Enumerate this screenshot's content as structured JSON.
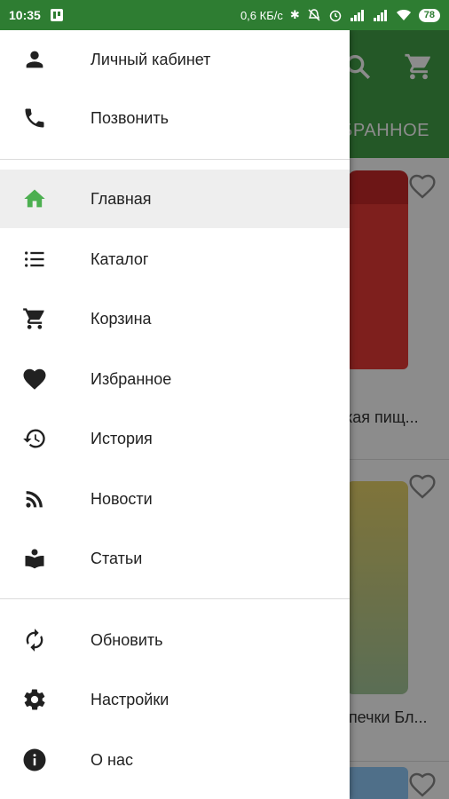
{
  "status_bar": {
    "time": "10:35",
    "network_speed": "0,6 КБ/с",
    "battery": "78"
  },
  "app": {
    "tab_label": "БРАННОЕ",
    "products": [
      {
        "title": "ская пищ..."
      },
      {
        "title": "ыпечки Бл..."
      }
    ]
  },
  "drawer": {
    "account": {
      "label": "Личный кабинет",
      "icon": "person-icon"
    },
    "call": {
      "label": "Позвонить",
      "icon": "phone-icon"
    },
    "items": [
      {
        "label": "Главная",
        "icon": "home-icon",
        "active": true
      },
      {
        "label": "Каталог",
        "icon": "list-icon"
      },
      {
        "label": "Корзина",
        "icon": "cart-icon"
      },
      {
        "label": "Избранное",
        "icon": "heart-icon"
      },
      {
        "label": "История",
        "icon": "history-icon"
      },
      {
        "label": "Новости",
        "icon": "rss-icon"
      },
      {
        "label": "Статьи",
        "icon": "book-icon"
      }
    ],
    "footer": [
      {
        "label": "Обновить",
        "icon": "refresh-icon"
      },
      {
        "label": "Настройки",
        "icon": "gear-icon"
      },
      {
        "label": "О нас",
        "icon": "info-icon"
      }
    ]
  },
  "colors": {
    "primary": "#43a047",
    "status_bar": "#2e7d32",
    "active_icon": "#4caf50"
  }
}
